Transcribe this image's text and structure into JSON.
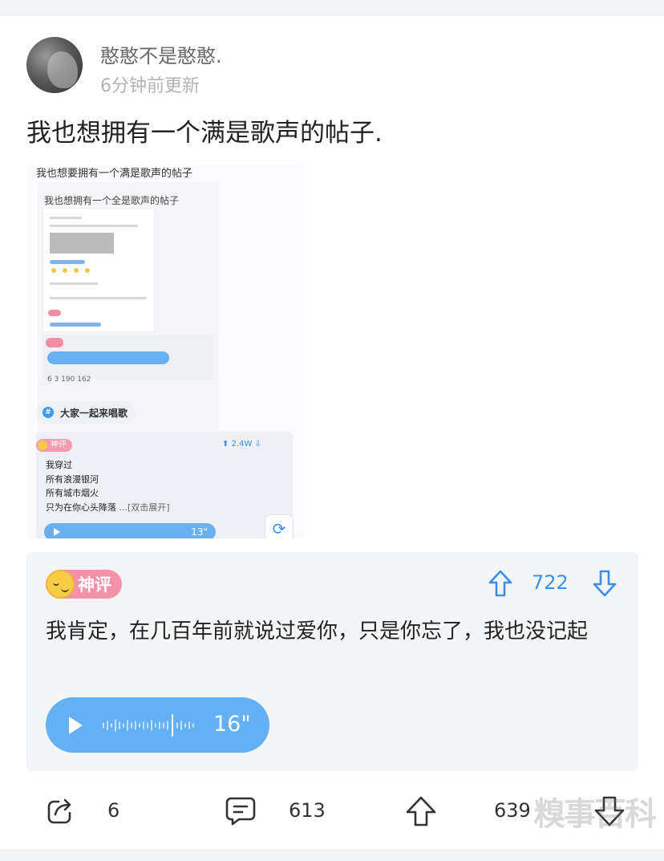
{
  "post": {
    "username": "憨憨不是憨憨.",
    "updated": "6分钟前更新",
    "title": "我也想拥有一个满是歌声的帖子."
  },
  "embedded_image": {
    "caption": "我也想要拥有一个满是歌声的帖子",
    "handwritten": "我也想拥有一个全是歌声的帖子",
    "mini_actions": "6  3      190      162",
    "topic_label": "大家一起来唱歌",
    "hot_badge": "神评",
    "hot_votes": "2.4W",
    "hot_lines": [
      "我穿过",
      "所有浪漫银河",
      "所有城市烟火",
      "只为在你心头降落"
    ],
    "more_label": "...[双击展开]",
    "voice_duration": "13\""
  },
  "hot_comment": {
    "badge": "神评",
    "vote_count": "722",
    "text": "我肯定，在几百年前就说过爱你，只是你忘了，我也没记起",
    "voice_duration": "16\""
  },
  "actions": {
    "share_count": "6",
    "comment_count": "613",
    "like_count": "639"
  },
  "watermark": "糗事百科",
  "colors": {
    "accent": "#3b8fe6",
    "voice": "#63b0f5",
    "badge": "#f493a8"
  }
}
